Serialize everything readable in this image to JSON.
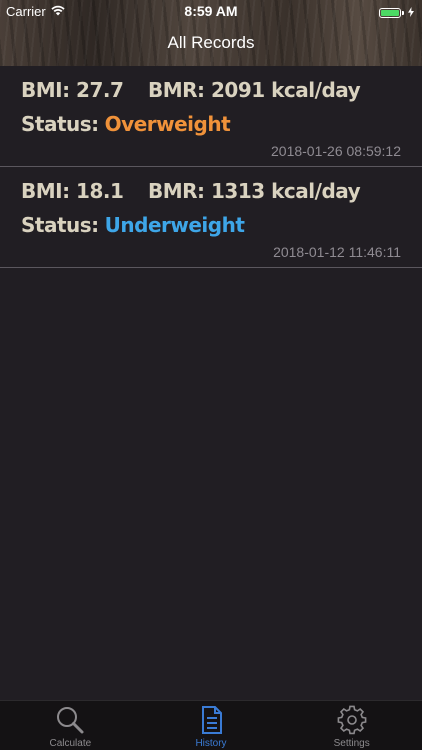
{
  "status_bar": {
    "carrier": "Carrier",
    "time": "8:59 AM",
    "battery_level": 1.0
  },
  "nav": {
    "title": "All Records"
  },
  "colors": {
    "overweight": "#f0923a",
    "underweight": "#3ea6e8",
    "tab_active": "#3a7bd5"
  },
  "records": [
    {
      "bmi": "BMI: 27.7",
      "bmr": "BMR: 2091 kcal/day",
      "status_label": "Status:",
      "status_value": "Overweight",
      "timestamp": "2018-01-26 08:59:12"
    },
    {
      "bmi": "BMI: 18.1",
      "bmr": "BMR: 1313 kcal/day",
      "status_label": "Status:",
      "status_value": "Underweight",
      "timestamp": "2018-01-12 11:46:11"
    }
  ],
  "tabbar": {
    "tabs": [
      {
        "label": "Calculate",
        "icon": "magnifier-icon",
        "active": false
      },
      {
        "label": "History",
        "icon": "document-icon",
        "active": true
      },
      {
        "label": "Settings",
        "icon": "gear-icon",
        "active": false
      }
    ]
  }
}
